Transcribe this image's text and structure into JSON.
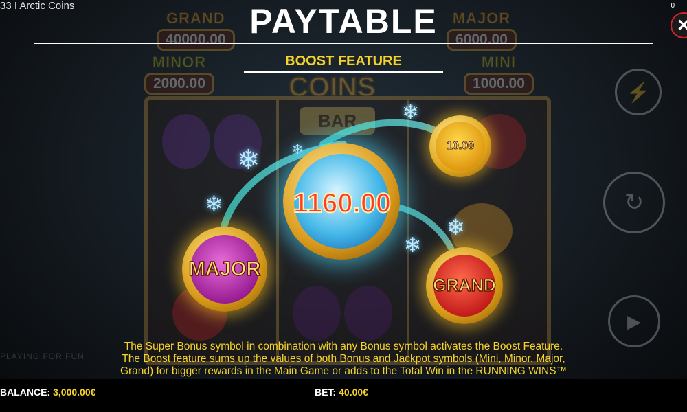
{
  "window": {
    "title": "33 I Arctic Coins",
    "counter": "0"
  },
  "background": {
    "jackpots": [
      {
        "label": "GRAND",
        "value": "40000.00"
      },
      {
        "label": "MAJOR",
        "value": "6000.00"
      },
      {
        "label": "MINOR",
        "value": "2000.00"
      },
      {
        "label": "MINI",
        "value": "1000.00"
      }
    ],
    "logo": "COINS",
    "bar_symbol": "BAR",
    "playing_text": "PLAYING FOR FUN"
  },
  "paytable": {
    "title": "PAYTABLE",
    "section_title": "BOOST FEATURE",
    "close_icon": "close-icon",
    "coins": {
      "major_label": "MAJOR",
      "grand_label": "GRAND",
      "small_value": "10.00",
      "super_value": "1160.00"
    },
    "description": [
      "The Super Bonus symbol in combination with any Bonus symbol activates the Boost Feature.",
      "The Boost feature sums up the values of both Bonus and Jackpot symbols (Mini, Minor, Major,",
      "Grand) for bigger rewards in the Main Game or adds to the Total Win in the RUNNING WINS™"
    ]
  },
  "footer": {
    "balance_label": "BALANCE:",
    "balance_value": "3,000.00€",
    "bet_label": "BET:",
    "bet_value": "40.00€"
  },
  "colors": {
    "accent": "#f6d22a",
    "close_ring": "#d8232a"
  }
}
